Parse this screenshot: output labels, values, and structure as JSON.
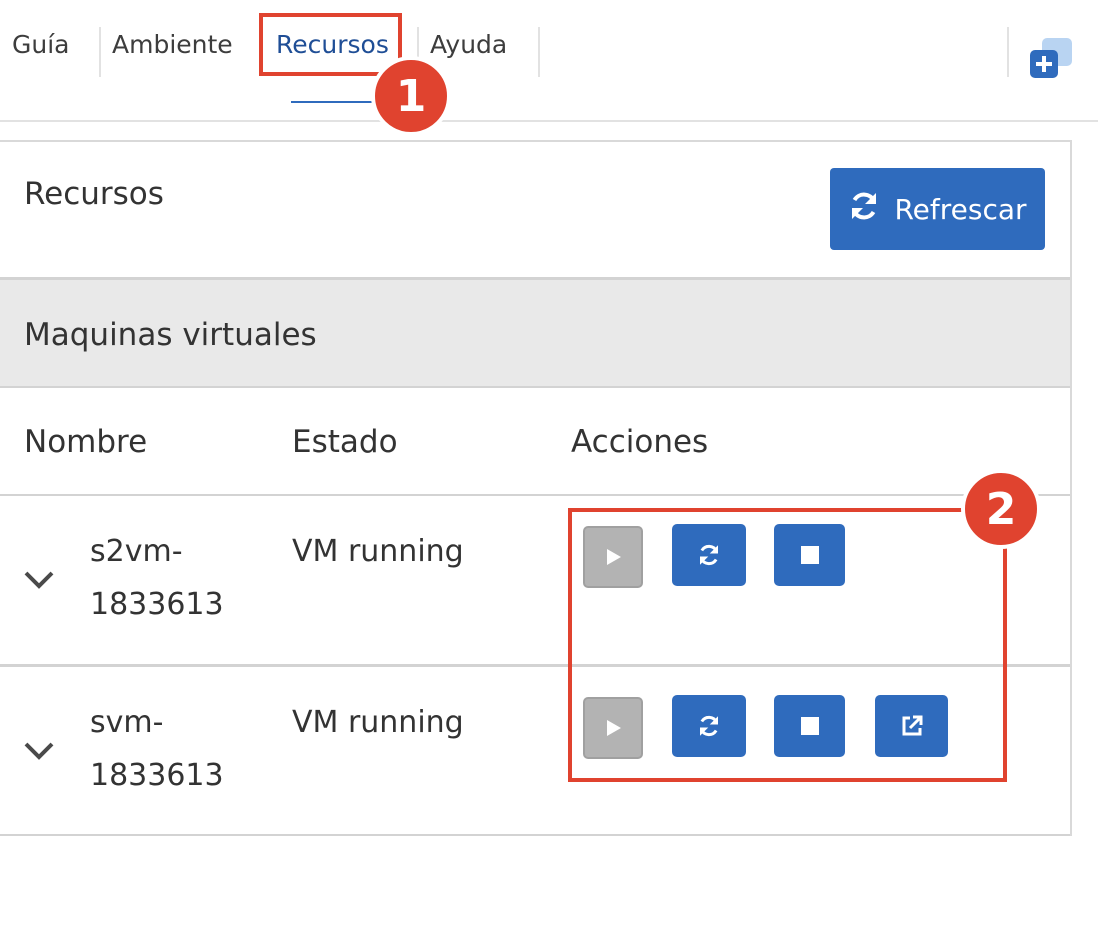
{
  "nav": {
    "tabs": [
      {
        "label": "Guía"
      },
      {
        "label": "Ambiente"
      },
      {
        "label": "Recursos",
        "active": true
      },
      {
        "label": "Ayuda"
      }
    ],
    "add_icon": "add-window-icon"
  },
  "callouts": [
    "1",
    "2"
  ],
  "panel": {
    "title": "Recursos",
    "refresh_label": "Refrescar",
    "section_title": "Maquinas virtuales",
    "columns": [
      "Nombre",
      "Estado",
      "Acciones"
    ],
    "rows": [
      {
        "name_line1": "s2vm-",
        "name_line2": "1833613",
        "status": "VM running",
        "actions": [
          "play-icon",
          "refresh-icon",
          "stop-icon"
        ]
      },
      {
        "name_line1": "svm-",
        "name_line2": "1833613",
        "status": "VM running",
        "actions": [
          "play-icon",
          "refresh-icon",
          "stop-icon",
          "external-link-icon"
        ]
      }
    ]
  },
  "colors": {
    "primary": "#2f6bbd",
    "highlight": "#e0432f",
    "disabled": "#b3b3b3",
    "section_bg": "#e9e9e9"
  }
}
